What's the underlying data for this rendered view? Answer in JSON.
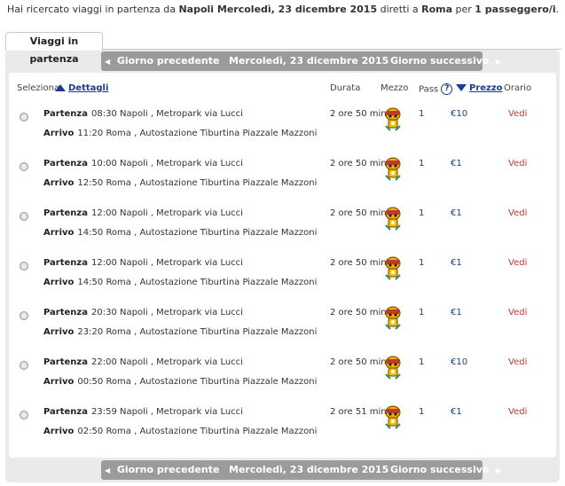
{
  "summary": {
    "prefix": "Hai ricercato viaggi in partenza da ",
    "origin_date": "Napoli Mercoledì, 23 dicembre 2015",
    "mid": " diretti a ",
    "destination": "Roma",
    "per": " per ",
    "passengers": "1 passeggero/i",
    "end": "."
  },
  "tab": {
    "label": "Viaggi in partenza"
  },
  "nav": {
    "prev_label": "Giorno precedente",
    "date_label": "Mercoledì, 23 dicembre 2015",
    "next_label": "Giorno successivo",
    "prev_arrow": "◀",
    "next_arrow": "▶"
  },
  "headers": {
    "seleziona": "Seleziona",
    "dettagli": "Dettagli",
    "durata": "Durata",
    "mezzo": "Mezzo",
    "pass": "Pass",
    "help": "?",
    "prezzo": "Prezzo",
    "orario": "Orario"
  },
  "labels": {
    "partenza": "Partenza",
    "arrivo": "Arrivo",
    "vedi": "Vedi"
  },
  "trips": [
    {
      "dep_time": "08:30",
      "dep_place": "Napoli , Metropark via Lucci",
      "arr_time": "11:20",
      "arr_place": "Roma , Autostazione Tiburtina Piazzale Mazzoni",
      "duration": "2 ore 50 min",
      "pass": "1",
      "price": "€10"
    },
    {
      "dep_time": "10:00",
      "dep_place": "Napoli , Metropark via Lucci",
      "arr_time": "12:50",
      "arr_place": "Roma , Autostazione Tiburtina Piazzale Mazzoni",
      "duration": "2 ore 50 min",
      "pass": "1",
      "price": "€1"
    },
    {
      "dep_time": "12:00",
      "dep_place": "Napoli , Metropark via Lucci",
      "arr_time": "14:50",
      "arr_place": "Roma , Autostazione Tiburtina Piazzale Mazzoni",
      "duration": "2 ore 50 min",
      "pass": "1",
      "price": "€1"
    },
    {
      "dep_time": "12:00",
      "dep_place": "Napoli , Metropark via Lucci",
      "arr_time": "14:50",
      "arr_place": "Roma , Autostazione Tiburtina Piazzale Mazzoni",
      "duration": "2 ore 50 min",
      "pass": "1",
      "price": "€1"
    },
    {
      "dep_time": "20:30",
      "dep_place": "Napoli , Metropark via Lucci",
      "arr_time": "23:20",
      "arr_place": "Roma , Autostazione Tiburtina Piazzale Mazzoni",
      "duration": "2 ore 50 min",
      "pass": "1",
      "price": "€1"
    },
    {
      "dep_time": "22:00",
      "dep_place": "Napoli , Metropark via Lucci",
      "arr_time": "00:50",
      "arr_place": "Roma , Autostazione Tiburtina Piazzale Mazzoni",
      "duration": "2 ore 50 min",
      "pass": "1",
      "price": "€10"
    },
    {
      "dep_time": "23:59",
      "dep_place": "Napoli , Metropark via Lucci",
      "arr_time": "02:50",
      "arr_place": "Roma , Autostazione Tiburtina Piazzale Mazzoni",
      "duration": "2 ore 51 min",
      "pass": "1",
      "price": "€1"
    }
  ],
  "icons": {
    "bus": "bus-mascot-icon"
  },
  "colors": {
    "nav_bg": "#9b9b9b",
    "link": "#1a3e8c",
    "vedi": "#c0392b"
  }
}
